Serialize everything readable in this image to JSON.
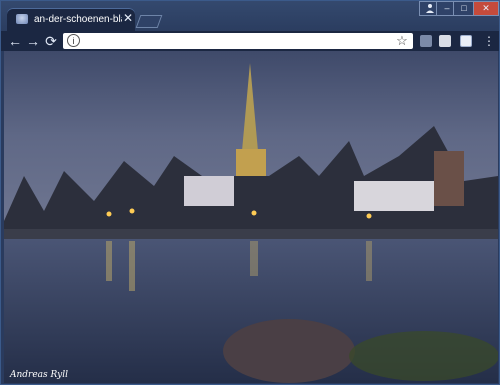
{
  "tab": {
    "title": "an-der-schoenen-blauen",
    "close_icon": "close-icon",
    "favicon": "page-favicon"
  },
  "window_controls": {
    "profile_icon": "user-icon",
    "minimize_label": "–",
    "maximize_label": "□",
    "close_label": "✕"
  },
  "toolbar": {
    "back_icon": "back-arrow-icon",
    "forward_icon": "forward-arrow-icon",
    "reload_icon": "reload-icon",
    "omnibox_value": "",
    "info_label": "i",
    "bookmark_icon": "star-icon",
    "extensions": [
      "extension-1-icon",
      "extension-2-icon",
      "extension-3-icon",
      "extension-4-icon"
    ],
    "menu_icon": "more-vert-icon"
  },
  "content": {
    "scene": "Ulm Minster city skyline at dusk reflected in the Danube",
    "photo_credit": "Andreas Ryll"
  },
  "colors": {
    "frame": "#2b3d60",
    "tab_active": "#1b2742",
    "omnibox": "#ffffff"
  }
}
